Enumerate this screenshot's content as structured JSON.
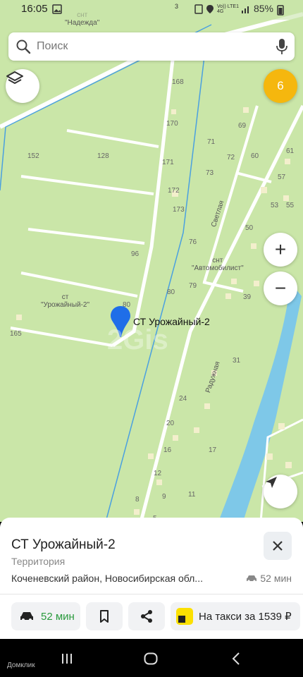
{
  "status_bar": {
    "time": "16:05",
    "notification_count": "3",
    "network": "Vo)) LTE1 4G",
    "battery": "85%"
  },
  "search": {
    "placeholder": "Поиск"
  },
  "map": {
    "layers_icon": "layers-icon",
    "badge_count": "6",
    "zoom_in": "+",
    "zoom_out": "−",
    "locate_icon": "navigation-arrow-icon",
    "pin_label": "СТ Урожайный-2",
    "watermark": "2Gis",
    "places": [
      {
        "type": "снт",
        "name": "\"Надежда\""
      },
      {
        "type": "снт",
        "name": "\"Автомобилист\""
      },
      {
        "type": "ст",
        "name": "\"Урожайный-2\""
      }
    ],
    "streets": [
      "Светлая",
      "Радужная"
    ],
    "house_numbers": [
      "168",
      "170",
      "69",
      "71",
      "72",
      "60",
      "61",
      "152",
      "128",
      "171",
      "73",
      "57",
      "172",
      "53",
      "173",
      "55",
      "50",
      "76",
      "96",
      "79",
      "80",
      "39",
      "80",
      "165",
      "31",
      "24",
      "20",
      "17",
      "16",
      "12",
      "8",
      "9",
      "11",
      "5"
    ]
  },
  "sheet": {
    "title": "СТ Урожайный-2",
    "subtitle": "Территория",
    "address": "Коченевский район, Новосибирская обл...",
    "eta_small": "52 мин",
    "actions": {
      "route_label": "52 мин",
      "taxi_label": "На такси за 1539 ₽"
    }
  },
  "navbar": {
    "brand": "Домклик"
  },
  "colors": {
    "map_bg": "#cae6a8",
    "road": "#ffffff",
    "water": "#7ec8e8",
    "accent_green": "#2a9a3d",
    "badge": "#f5b70e",
    "pin": "#1f6ee8"
  }
}
